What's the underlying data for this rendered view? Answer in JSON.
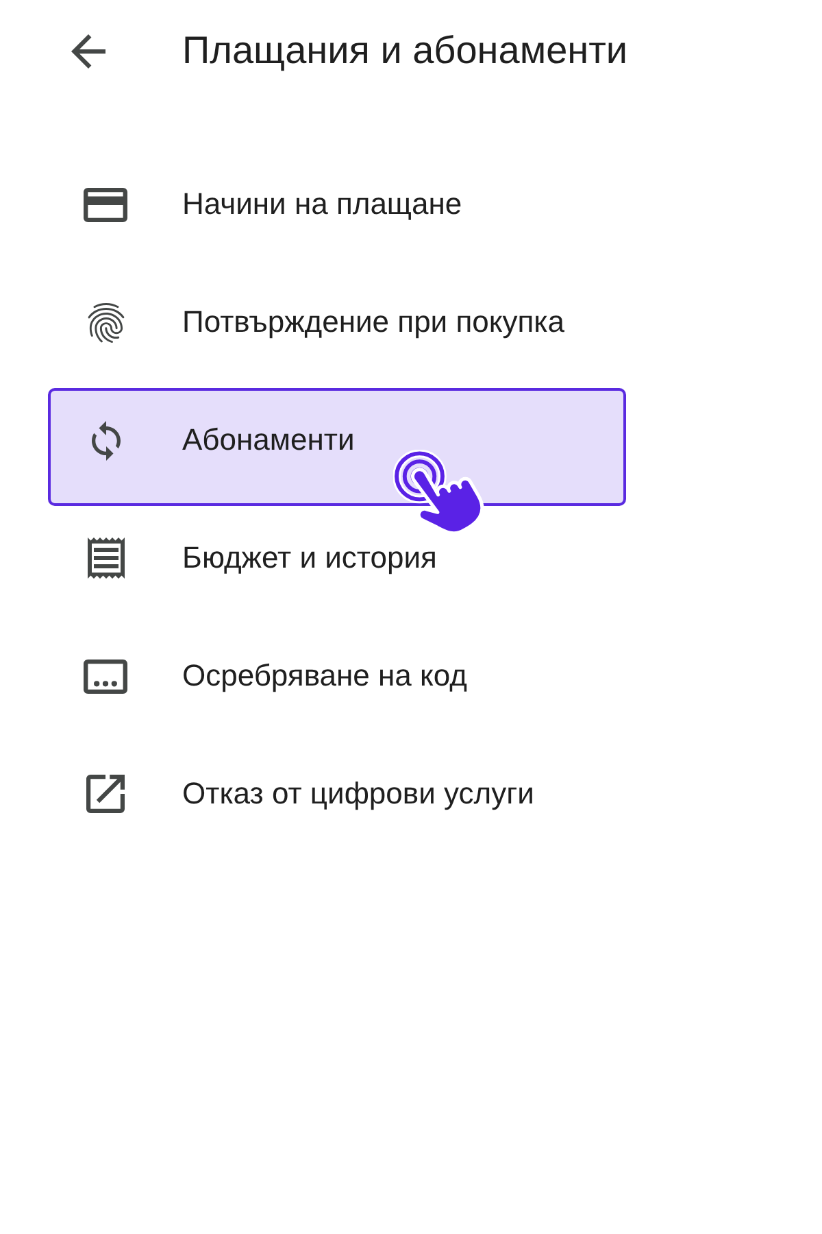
{
  "header": {
    "title": "Плащания и абонаменти"
  },
  "menu_items": [
    {
      "label": "Начини на плащане",
      "selected": false
    },
    {
      "label": "Потвърждение при покупка",
      "selected": false
    },
    {
      "label": "Абонаменти",
      "selected": true
    },
    {
      "label": "Бюджет и история",
      "selected": false
    },
    {
      "label": "Осребряване на код",
      "selected": false
    },
    {
      "label": "Отказ от цифрови услуги",
      "selected": false
    }
  ]
}
